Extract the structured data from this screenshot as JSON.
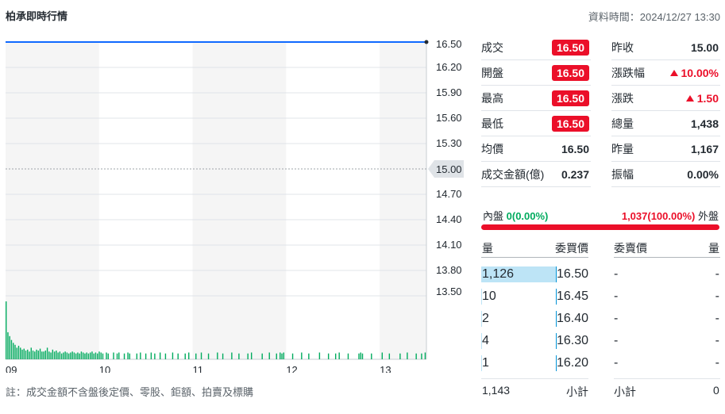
{
  "header": {
    "title": "柏承即時行情",
    "data_time": "資料時間：2024/12/27 13:30"
  },
  "note": "註：成交金額不含盤後定價、零股、鉅額、拍賣及標購",
  "chart_data": {
    "type": "line",
    "price_ticks": [
      "16.50",
      "16.20",
      "15.90",
      "15.60",
      "15.30",
      "15.00",
      "14.70",
      "14.40",
      "14.10",
      "13.80",
      "13.50"
    ],
    "ylim": [
      13.5,
      16.5
    ],
    "reference_price": "15.00",
    "x_ticks": [
      "09",
      "10",
      "11",
      "12",
      "13"
    ],
    "series": [
      {
        "values_x": [
          "09:00",
          "13:30"
        ],
        "values": [
          16.5,
          16.5
        ]
      }
    ],
    "volume_bars": [
      60,
      28,
      24,
      20,
      17,
      15,
      12,
      14,
      12,
      10,
      11,
      9,
      10,
      8,
      12,
      9,
      8,
      10,
      9,
      11,
      8,
      8,
      9,
      12,
      8,
      7,
      10,
      8,
      9,
      7,
      8,
      6,
      7,
      8,
      7,
      6,
      7,
      8,
      7,
      6,
      7,
      6,
      8,
      7,
      6,
      7,
      6,
      7,
      8,
      6,
      7,
      6,
      8,
      7,
      6,
      0,
      7,
      6,
      0,
      0,
      7,
      0,
      6,
      7,
      0,
      0,
      6,
      0,
      7,
      6,
      0,
      0,
      0,
      6,
      0,
      7,
      0,
      0,
      6,
      0,
      0,
      7,
      0,
      6,
      0,
      0,
      7,
      0,
      0,
      6,
      0,
      0,
      0,
      7,
      0,
      0,
      6,
      0,
      0,
      0,
      6,
      0,
      7,
      0,
      0,
      0,
      6,
      0,
      0,
      7,
      0,
      0,
      0,
      6,
      0,
      0,
      0,
      0,
      7,
      0,
      0,
      6,
      0,
      0,
      0,
      0,
      7,
      0,
      0,
      0,
      6,
      0,
      0,
      0,
      0,
      6,
      0,
      7,
      0,
      0,
      0,
      0,
      0,
      6,
      0,
      0,
      0,
      7,
      0,
      0,
      0,
      6,
      0,
      7,
      6,
      7,
      0,
      0,
      0,
      0,
      6,
      0,
      0,
      0,
      0,
      7,
      0,
      0,
      0,
      6,
      0,
      0,
      0,
      0,
      0,
      7,
      0,
      0,
      0,
      0,
      6,
      0,
      0,
      0,
      6,
      0,
      7,
      0,
      0,
      0,
      0,
      6,
      0,
      0,
      0,
      0,
      0,
      6,
      7,
      6,
      0,
      0,
      0,
      0,
      6,
      0,
      0,
      0,
      0,
      0,
      7,
      0,
      0,
      0,
      6,
      0,
      0,
      0,
      0,
      0,
      6,
      0,
      0,
      0,
      7,
      0,
      0,
      0,
      0,
      6,
      0,
      0,
      6,
      0,
      7
    ],
    "colors": {
      "price_line": "#0f69ff",
      "volume": "#00ab5e",
      "grid": "#e0e4e9",
      "band": "#f5f5f5"
    }
  },
  "stats": [
    {
      "label": "成交",
      "value": "16.50",
      "style": "badge",
      "label2": "昨收",
      "value2": "15.00",
      "style2": "plain"
    },
    {
      "label": "開盤",
      "value": "16.50",
      "style": "badge",
      "label2": "漲跌幅",
      "value2": "10.00%",
      "style2": "up"
    },
    {
      "label": "最高",
      "value": "16.50",
      "style": "badge",
      "label2": "漲跌",
      "value2": "1.50",
      "style2": "up"
    },
    {
      "label": "最低",
      "value": "16.50",
      "style": "badge",
      "label2": "總量",
      "value2": "1,438",
      "style2": "plain"
    },
    {
      "label": "均價",
      "value": "16.50",
      "style": "plain",
      "label2": "昨量",
      "value2": "1,167",
      "style2": "plain"
    },
    {
      "label": "成交金額(億)",
      "value": "0.237",
      "style": "plain",
      "label2": "振幅",
      "value2": "0.00%",
      "style2": "plain"
    }
  ],
  "inout": {
    "inner_label": "內盤",
    "inner_value": "0(0.00%)",
    "outer_value": "1,037(100.00%)",
    "outer_label": "外盤",
    "outer_ratio": 1.0
  },
  "orderbook": {
    "headers": {
      "bid_vol": "量",
      "bid_price": "委買價",
      "ask_price": "委賣價",
      "ask_vol": "量"
    },
    "rows": [
      {
        "bid_vol": "1,126",
        "bid_price": "16.50",
        "ask_price": "-",
        "ask_vol": "-",
        "bid_ratio": 1.0
      },
      {
        "bid_vol": "10",
        "bid_price": "16.45",
        "ask_price": "-",
        "ask_vol": "-",
        "bid_ratio": 0.01
      },
      {
        "bid_vol": "2",
        "bid_price": "16.40",
        "ask_price": "-",
        "ask_vol": "-",
        "bid_ratio": 0.002
      },
      {
        "bid_vol": "4",
        "bid_price": "16.30",
        "ask_price": "-",
        "ask_vol": "-",
        "bid_ratio": 0.004
      },
      {
        "bid_vol": "1",
        "bid_price": "16.20",
        "ask_price": "-",
        "ask_vol": "-",
        "bid_ratio": 0.001
      }
    ],
    "footer": {
      "bid_total": "1,143",
      "bid_label": "小計",
      "ask_label": "小計",
      "ask_total": "0"
    }
  }
}
